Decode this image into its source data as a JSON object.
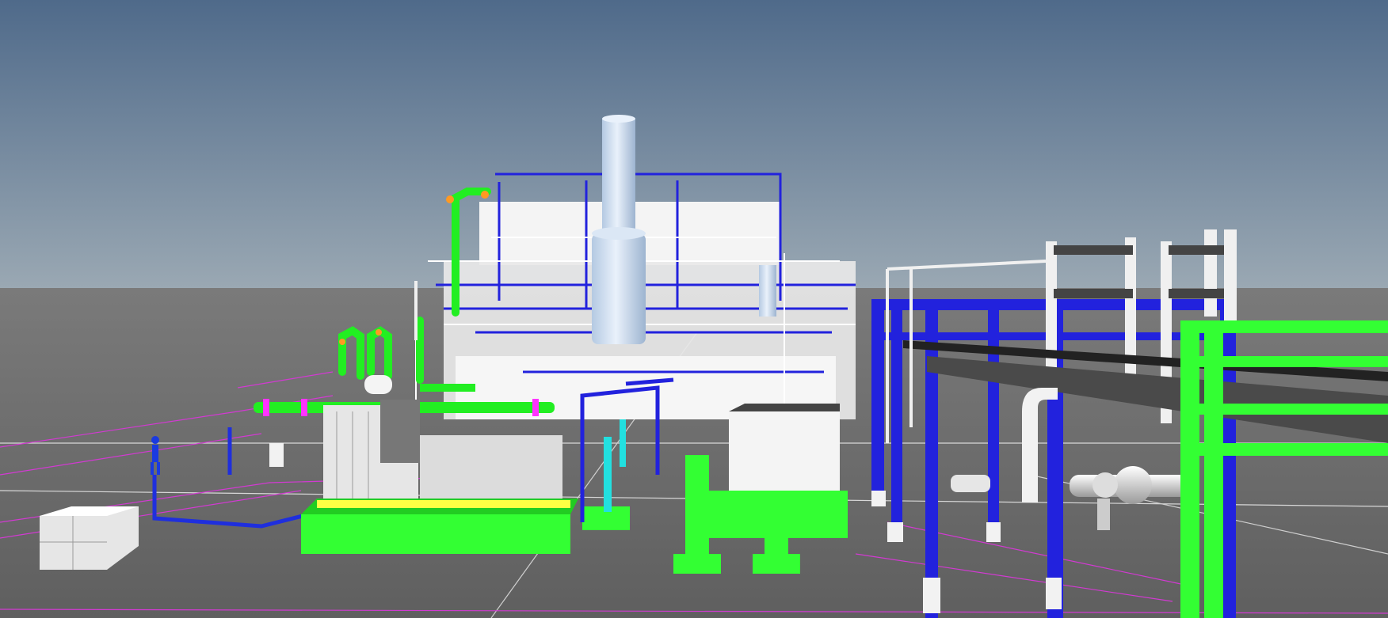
{
  "view": {
    "kind": "3d-plant-model-viewport",
    "text_elements": []
  },
  "colors": {
    "sky_top": "#4f6a8a",
    "sky_horizon": "#9aa8b3",
    "ground": "#6d6d6d",
    "structure_blue": "#2222dd",
    "pipe_green": "#22ee22",
    "skid_green": "#33ff33",
    "equipment_white": "#f2f2f2",
    "stack_lightblue": "#c9dcf2",
    "grid_magenta": "#d23ad2",
    "grid_white": "#dcdcdc",
    "accent_yellow": "#ffff44",
    "accent_cyan": "#22e0e0",
    "flange_orange": "#ff9922",
    "flange_magenta": "#ff33ff"
  },
  "icons": {
    "person_marker": "person-icon"
  }
}
